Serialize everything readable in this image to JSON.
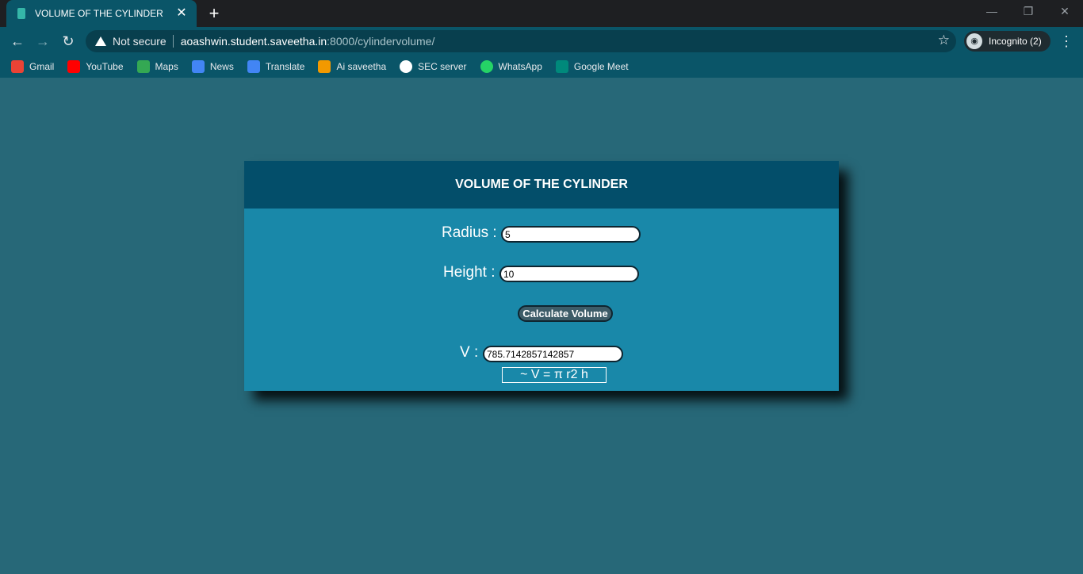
{
  "browser": {
    "tab": {
      "title": "VOLUME OF THE CYLINDER",
      "close_glyph": "✕",
      "favicon": "page-icon"
    },
    "new_tab_glyph": "+",
    "window_controls": {
      "minimize": "—",
      "maximize": "❐",
      "close": "✕"
    },
    "nav": {
      "back": "←",
      "forward": "→",
      "reload": "↻"
    },
    "address": {
      "security_text": "Not secure",
      "host": "aoashwin.student.saveetha.in",
      "path": ":8000/cylindervolume/"
    },
    "star_glyph": "☆",
    "incognito": {
      "label": "Incognito (2)",
      "icon_glyph": "◉"
    },
    "menu_glyph": "⋮",
    "bookmarks": [
      {
        "label": "Gmail",
        "color": "#ea4335"
      },
      {
        "label": "YouTube",
        "color": "#ff0000"
      },
      {
        "label": "Maps",
        "color": "#34a853"
      },
      {
        "label": "News",
        "color": "#4285f4"
      },
      {
        "label": "Translate",
        "color": "#4285f4"
      },
      {
        "label": "Ai saveetha",
        "color": "#f29900"
      },
      {
        "label": "SEC server",
        "color": "#ffffff"
      },
      {
        "label": "WhatsApp",
        "color": "#25d366"
      },
      {
        "label": "Google Meet",
        "color": "#00897b"
      }
    ]
  },
  "page": {
    "title": "VOLUME OF THE CYLINDER",
    "radius": {
      "label": "Radius :",
      "value": "5"
    },
    "height": {
      "label": "Height :",
      "value": "10"
    },
    "calculate_label": "Calculate Volume",
    "volume": {
      "label": "V :",
      "value": "785.7142857142857"
    },
    "formula": "~ V = π r2 h"
  },
  "colors": {
    "page_bg": "#276878",
    "card_bg": "#1988a9",
    "header_bg": "#034e6a",
    "chrome_bg": "#0a5568"
  }
}
